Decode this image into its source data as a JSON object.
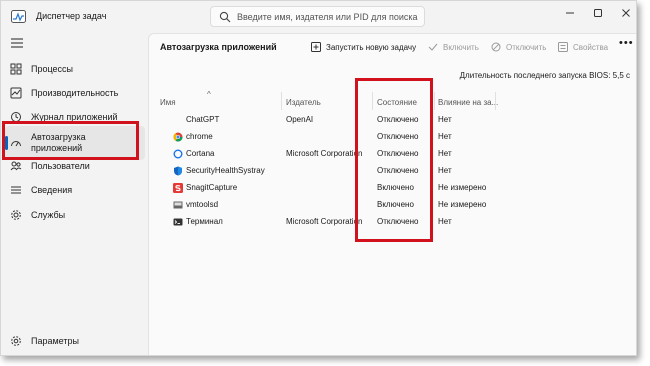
{
  "window": {
    "title": "Диспетчер задач",
    "search_placeholder": "Введите имя, издателя или PID для поиска"
  },
  "sidebar": {
    "items": [
      {
        "label": "Процессы",
        "icon": "processes-grid-icon"
      },
      {
        "label": "Производительность",
        "icon": "performance-chart-icon"
      },
      {
        "label": "Журнал приложений",
        "icon": "history-icon"
      },
      {
        "label": "Автозагрузка приложений",
        "icon": "speedometer-icon",
        "active": true
      },
      {
        "label": "Пользователи",
        "icon": "users-icon"
      },
      {
        "label": "Сведения",
        "icon": "details-list-icon"
      },
      {
        "label": "Службы",
        "icon": "services-gear-icon"
      }
    ],
    "settings_label": "Параметры"
  },
  "main": {
    "title": "Автозагрузка приложений",
    "toolbar": {
      "run_new_task": "Запустить новую задачу",
      "enable": "Включить",
      "disable": "Отключить",
      "properties": "Свойства"
    },
    "bios_info": "Длительность последнего запуска BIOS: 5,5 с",
    "columns": {
      "name": "Имя",
      "publisher": "Издатель",
      "status": "Состояние",
      "impact": "Влияние на за..."
    },
    "rows": [
      {
        "name": "ChatGPT",
        "publisher": "OpenAI",
        "status": "Отключено",
        "impact": "Нет",
        "icon": "chatgpt-icon"
      },
      {
        "name": "chrome",
        "publisher": "",
        "status": "Отключено",
        "impact": "Нет",
        "icon": "chrome-icon"
      },
      {
        "name": "Cortana",
        "publisher": "Microsoft Corporation",
        "status": "Отключено",
        "impact": "Нет",
        "icon": "cortana-icon"
      },
      {
        "name": "SecurityHealthSystray",
        "publisher": "",
        "status": "Отключено",
        "impact": "Нет",
        "icon": "shield-icon"
      },
      {
        "name": "SnagitCapture",
        "publisher": "",
        "status": "Включено",
        "impact": "Не измерено",
        "icon": "snagit-icon"
      },
      {
        "name": "vmtoolsd",
        "publisher": "",
        "status": "Включено",
        "impact": "Не измерено",
        "icon": "vmtools-icon"
      },
      {
        "name": "Терминал",
        "publisher": "Microsoft Corporation",
        "status": "Отключено",
        "impact": "Нет",
        "icon": "terminal-icon"
      }
    ]
  },
  "colors": {
    "accent": "#0067c0",
    "highlight": "#d1111b"
  }
}
